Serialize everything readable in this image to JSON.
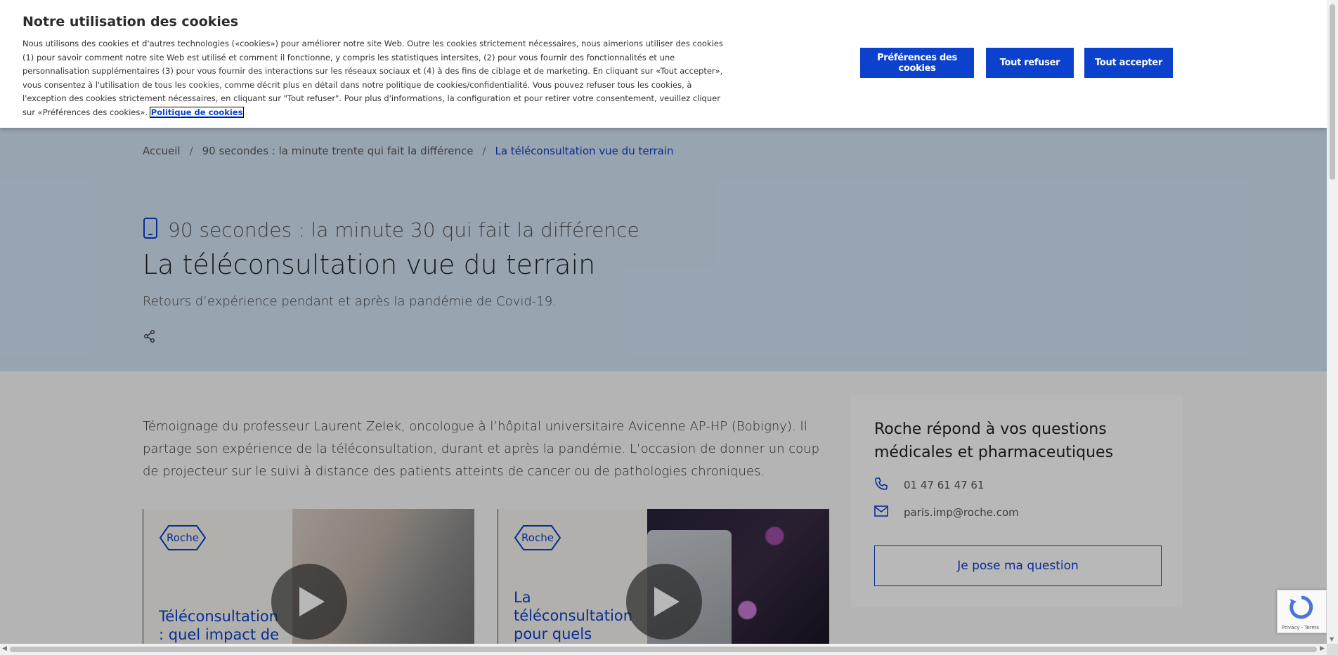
{
  "cookie_banner": {
    "title": "Notre utilisation des cookies",
    "text": "Nous utilisons des cookies et d'autres technologies («cookies») pour améliorer notre site Web. Outre les cookies strictement nécessaires, nous aimerions utiliser des cookies (1) pour savoir comment notre site Web est utilisé et comment il fonctionne, y compris les statistiques intersites, (2) pour vous fournir des fonctionnalités et une personnalisation supplémentaires (3) pour vous fournir des interactions sur les réseaux sociaux et (4) à des fins de ciblage et de marketing. En cliquant sur «Tout accepter», vous consentez à l'utilisation de tous les cookies, comme décrit plus en détail dans notre politique de cookies/confidentialité. Vous pouvez refuser tous les cookies, à l'exception des cookies strictement nécessaires, en cliquant sur \"Tout refuser\". Pour plus d'informations, la configuration et pour retirer votre consentement, veuillez cliquer sur «Préférences des cookies».",
    "policy_link": "Politique de cookies",
    "btn_preferences": "Préférences des cookies",
    "btn_refuse": "Tout refuser",
    "btn_accept": "Tout accepter"
  },
  "breadcrumb": {
    "items": [
      "Accueil",
      "90 secondes : la minute trente qui fait la différence",
      "La téléconsultation vue du terrain"
    ],
    "separator": "/"
  },
  "hero": {
    "kicker": "90 secondes : la minute 30 qui fait la différence",
    "title": "La téléconsultation vue du terrain",
    "subtitle": "Retours d’expérience pendant et après la pandémie de Covid-19."
  },
  "intro": "Témoignage du professeur Laurent Zelek, oncologue à l’hôpital universitaire Avicenne AP-HP (Bobigny). Il partage son expérience de la téléconsultation, durant et après la pandémie. L’occasion de donner un coup de projecteur sur le suivi à distance des patients atteints de cancer ou de pathologies chroniques.",
  "videos": [
    {
      "logo": "Roche",
      "title": "Téléconsultation : quel impact de la"
    },
    {
      "logo": "Roche",
      "title": "La téléconsultation pour quels"
    }
  ],
  "sidebar": {
    "title": "Roche répond à vos questions médicales et pharmaceutiques",
    "phone": "01 47 61 47 61",
    "email": "paris.imp@roche.com",
    "button": "Je pose ma question"
  },
  "recaptcha": {
    "text": "Privacy - Terms"
  },
  "colors": {
    "brand_blue": "#0b41cd",
    "hero_bg": "#d4e4f6"
  }
}
